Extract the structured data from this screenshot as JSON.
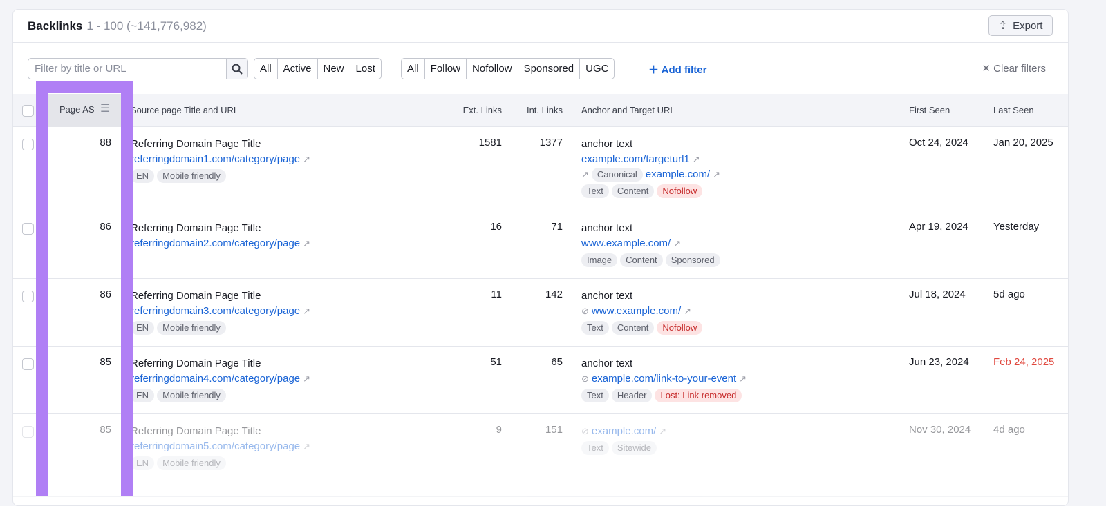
{
  "header": {
    "title": "Backlinks",
    "count": "1 - 100 (~141,776,982)",
    "export_label": "Export"
  },
  "filters": {
    "search_placeholder": "Filter by title or URL",
    "status": [
      "All",
      "Active",
      "New",
      "Lost"
    ],
    "type": [
      "All",
      "Follow",
      "Nofollow",
      "Sponsored",
      "UGC"
    ],
    "add_filter": "Add filter",
    "clear_filters": "Clear filters"
  },
  "columns": {
    "page_as": "Page AS",
    "source": "Source page Title and URL",
    "ext": "Ext. Links",
    "int": "Int. Links",
    "anchor": "Anchor and Target URL",
    "first": "First Seen",
    "last": "Last Seen"
  },
  "rows": [
    {
      "as": "88",
      "title": "Referring Domain Page Title",
      "url": "referringdomain1.com/category/page",
      "tags": [
        "EN",
        "Mobile friendly"
      ],
      "ext": "1581",
      "int": "1377",
      "anchor": "anchor text",
      "target": "example.com/targeturl1",
      "canonical_label": "Canonical",
      "canonical_url": "example.com/",
      "atags": [
        "Text",
        "Content",
        "Nofollow"
      ],
      "first": "Oct 24, 2024",
      "last": "Jan 20, 2025"
    },
    {
      "as": "86",
      "title": "Referring Domain Page Title",
      "url": "referringdomain2.com/category/page",
      "tags": [],
      "ext": "16",
      "int": "71",
      "anchor": "anchor text",
      "target": "www.example.com/",
      "atags": [
        "Image",
        "Content",
        "Sponsored"
      ],
      "first": "Apr 19, 2024",
      "last": "Yesterday"
    },
    {
      "as": "86",
      "title": "Referring Domain Page Title",
      "url": "referringdomain3.com/category/page",
      "tags": [
        "EN",
        "Mobile friendly"
      ],
      "ext": "11",
      "int": "142",
      "anchor": "anchor text",
      "target": "www.example.com/",
      "atags": [
        "Text",
        "Content",
        "Nofollow"
      ],
      "first": "Jul 18, 2024",
      "last": "5d ago"
    },
    {
      "as": "85",
      "title": "Referring Domain Page Title",
      "url": "referringdomain4.com/category/page",
      "tags": [
        "EN",
        "Mobile friendly"
      ],
      "ext": "51",
      "int": "65",
      "anchor": "anchor text",
      "target": "example.com/link-to-your-event",
      "atags": [
        "Text",
        "Header",
        "Lost: Link removed"
      ],
      "first": "Jun 23, 2024",
      "last": "Feb 24, 2025"
    },
    {
      "as": "85",
      "title": "Referring Domain Page Title",
      "url": "referringdomain5.com/category/page",
      "tags": [
        "EN",
        "Mobile friendly"
      ],
      "ext": "9",
      "int": "151",
      "target": "example.com/",
      "atags": [
        "Text",
        "Sitewide"
      ],
      "first": "Nov 30, 2024",
      "last": "4d ago"
    }
  ],
  "colors": {
    "highlight": "#b07ff5",
    "link": "#1a64d6",
    "lost": "#e0483e"
  }
}
